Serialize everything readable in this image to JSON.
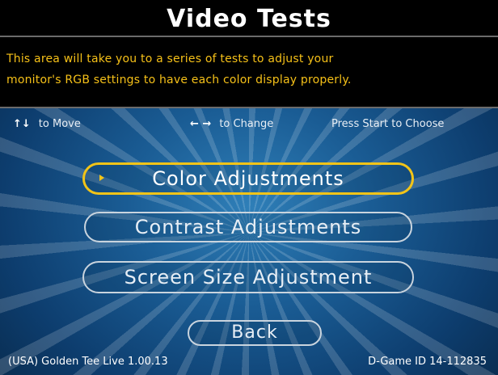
{
  "screen": {
    "title": "Video Tests",
    "description_line1": "This area will take you to a series of tests to adjust your",
    "description_line2": "monitor's RGB settings to have each color display properly."
  },
  "hints": {
    "move_arrows": "↑↓",
    "move_label": "to Move",
    "change_arrows": "← →",
    "change_label": "to Change",
    "start_label": "Press Start to Choose"
  },
  "menu": {
    "items": [
      {
        "label": "Color Adjustments",
        "selected": true
      },
      {
        "label": "Contrast Adjustments",
        "selected": false
      },
      {
        "label": "Screen Size Adjustment",
        "selected": false
      }
    ],
    "back_label": "Back"
  },
  "footer": {
    "version": "(USA) Golden Tee Live 1.00.13",
    "game_id": "D-Game ID 14-112835"
  },
  "colors": {
    "accent": "#f2c418",
    "text": "#ffffff",
    "background_top": "#000000",
    "background": "#1a5c94"
  }
}
